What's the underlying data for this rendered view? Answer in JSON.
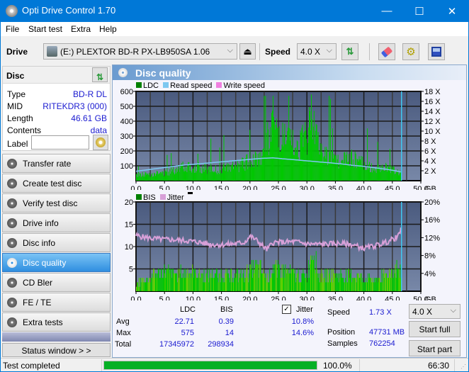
{
  "window": {
    "title": "Opti Drive Control 1.70",
    "minimize_glyph": "—",
    "maximize_glyph": "☐",
    "close_glyph": "✕"
  },
  "menu": [
    "File",
    "Start test",
    "Extra",
    "Help"
  ],
  "toolbar": {
    "drive_label": "Drive",
    "drive_value": "(E:)  PLEXTOR BD-R  PX-LB950SA 1.06",
    "speed_label": "Speed",
    "speed_value": "4.0 X",
    "icons": [
      "eject-icon",
      "refresh-icon",
      "erase-icon",
      "settings-icon",
      "save-icon"
    ]
  },
  "disc": {
    "header": "Disc",
    "fields": [
      {
        "key": "Type",
        "value": "BD-R DL"
      },
      {
        "key": "MID",
        "value": "RITEKDR3 (000)"
      },
      {
        "key": "Length",
        "value": "46.61 GB"
      },
      {
        "key": "Contents",
        "value": "data"
      }
    ],
    "label_key": "Label",
    "label_value": ""
  },
  "nav": {
    "items": [
      {
        "label": "Transfer rate",
        "active": false
      },
      {
        "label": "Create test disc",
        "active": false
      },
      {
        "label": "Verify test disc",
        "active": false
      },
      {
        "label": "Drive info",
        "active": false
      },
      {
        "label": "Disc info",
        "active": false
      },
      {
        "label": "Disc quality",
        "active": true
      },
      {
        "label": "CD Bler",
        "active": false
      },
      {
        "label": "FE / TE",
        "active": false
      },
      {
        "label": "Extra tests",
        "active": false
      }
    ],
    "status_window_label": "Status window > >"
  },
  "panel": {
    "title": "Disc quality"
  },
  "colors": {
    "ldc": "#00c800",
    "bis": "#00c800",
    "read_speed": "#7dc8f0",
    "write_speed": "#f080e0",
    "jitter": "#d8a0d8",
    "plot_bg_top": "#4a5a7e",
    "plot_bg_bottom": "#7888a8",
    "accent": "#0078d7",
    "value_text": "#1a1ad0"
  },
  "chart_data": [
    {
      "type": "bar",
      "title": "LDC",
      "legend": [
        "LDC",
        "Read speed",
        "Write speed"
      ],
      "legend_placement": "top-left",
      "xlabel": "GB",
      "x_ticks": [
        "0.0",
        "5.0",
        "10.0",
        "15.0",
        "20.0",
        "25.0",
        "30.0",
        "35.0",
        "40.0",
        "45.0",
        "50.0"
      ],
      "xlim": [
        0,
        50
      ],
      "y_left_ticks": [
        "100",
        "200",
        "300",
        "400",
        "500",
        "600"
      ],
      "ylim_left": [
        0,
        600
      ],
      "y_right_ticks": [
        "2 X",
        "4 X",
        "6 X",
        "8 X",
        "10 X",
        "12 X",
        "14 X",
        "16 X",
        "18 X"
      ],
      "ylim_right": [
        0,
        18
      ],
      "grid": true,
      "end_marker_gb": 46.61,
      "series": [
        {
          "name": "LDC",
          "x": [
            0,
            2,
            4,
            6,
            8,
            10,
            12,
            14,
            16,
            18,
            20,
            22,
            23,
            24,
            25,
            26,
            28,
            30,
            31,
            32,
            34,
            36,
            38,
            40,
            42,
            44,
            46,
            46.6
          ],
          "values": [
            40,
            50,
            55,
            60,
            120,
            100,
            90,
            80,
            95,
            110,
            150,
            190,
            300,
            400,
            330,
            300,
            250,
            320,
            560,
            240,
            170,
            140,
            170,
            120,
            80,
            100,
            60,
            70
          ],
          "peaks": [
            100,
            170,
            140,
            220,
            180,
            300,
            340,
            310,
            380,
            420,
            450,
            480,
            550,
            420,
            310,
            300,
            260,
            270
          ]
        },
        {
          "name": "Read speed",
          "x": [
            0,
            2,
            4,
            6,
            8,
            10,
            12,
            14,
            16,
            18,
            20,
            22,
            24,
            26,
            28,
            30,
            32,
            34,
            36,
            38,
            40,
            42,
            44,
            46,
            46.6
          ],
          "values": [
            1.9,
            2.2,
            2.5,
            2.8,
            3.1,
            3.3,
            3.5,
            3.7,
            3.9,
            4.1,
            4.3,
            4.5,
            4.6,
            4.4,
            4.2,
            4.0,
            3.8,
            3.6,
            3.4,
            3.1,
            2.9,
            2.6,
            2.3,
            1.9,
            1.73
          ]
        }
      ]
    },
    {
      "type": "bar",
      "title": "BIS",
      "legend": [
        "BIS",
        "Jitter"
      ],
      "legend_placement": "top-left",
      "xlabel": "GB",
      "x_ticks": [
        "0.0",
        "5.0",
        "10.0",
        "15.0",
        "20.0",
        "25.0",
        "30.0",
        "35.0",
        "40.0",
        "45.0",
        "50.0"
      ],
      "xlim": [
        0,
        50
      ],
      "y_left_ticks": [
        "5",
        "10",
        "15",
        "20"
      ],
      "ylim_left": [
        0,
        20
      ],
      "y_right_ticks": [
        "4%",
        "8%",
        "12%",
        "16%",
        "20%"
      ],
      "ylim_right": [
        0,
        20
      ],
      "grid": true,
      "end_marker_gb": 46.61,
      "series": [
        {
          "name": "BIS",
          "x": [
            0,
            2,
            3,
            5,
            7,
            9,
            11,
            13,
            15,
            17,
            19,
            20,
            21,
            22,
            23,
            24,
            26,
            28,
            30,
            31,
            32,
            34,
            36,
            38,
            40,
            42,
            44,
            45,
            46,
            46.6
          ],
          "values": [
            2,
            3,
            4,
            5,
            4,
            5,
            4,
            4,
            4,
            4,
            4,
            5,
            6,
            5,
            3,
            6,
            5,
            4,
            4,
            11,
            4,
            4,
            4,
            4,
            3,
            3,
            4,
            5,
            6,
            4
          ]
        },
        {
          "name": "Jitter",
          "x": [
            0,
            1,
            3,
            5,
            7,
            9,
            11,
            13,
            15,
            17,
            19,
            20,
            21,
            22,
            23,
            24,
            26,
            28,
            30,
            32,
            34,
            36,
            38,
            40,
            42,
            44,
            45,
            46,
            46.6
          ],
          "values": [
            12.5,
            12.2,
            11.8,
            11.6,
            11.5,
            11.3,
            11.0,
            10.5,
            10.4,
            10.6,
            10.9,
            12.3,
            11.6,
            10.4,
            9.3,
            10.9,
            11.0,
            11.1,
            10.6,
            10.5,
            10.6,
            10.7,
            10.4,
            9.6,
            10.2,
            11.0,
            11.6,
            12.2,
            14.0
          ]
        }
      ]
    }
  ],
  "stats": {
    "col_ldc": "LDC",
    "col_bis": "BIS",
    "col_jitter": "Jitter",
    "jitter_checked": true,
    "rows": [
      {
        "label": "Avg",
        "ldc": "22.71",
        "bis": "0.39",
        "jitter": "10.8%"
      },
      {
        "label": "Max",
        "ldc": "575",
        "bis": "14",
        "jitter": "14.6%"
      },
      {
        "label": "Total",
        "ldc": "17345972",
        "bis": "298934",
        "jitter": ""
      }
    ],
    "speed_label": "Speed",
    "speed_value": "1.73 X",
    "position_label": "Position",
    "position_value": "47731 MB",
    "samples_label": "Samples",
    "samples_value": "762254",
    "speed_select": "4.0 X",
    "start_full": "Start full",
    "start_part": "Start part"
  },
  "statusbar": {
    "status_text": "Test completed",
    "progress_percent": 100,
    "progress_text": "100.0%",
    "elapsed": "66:30"
  }
}
